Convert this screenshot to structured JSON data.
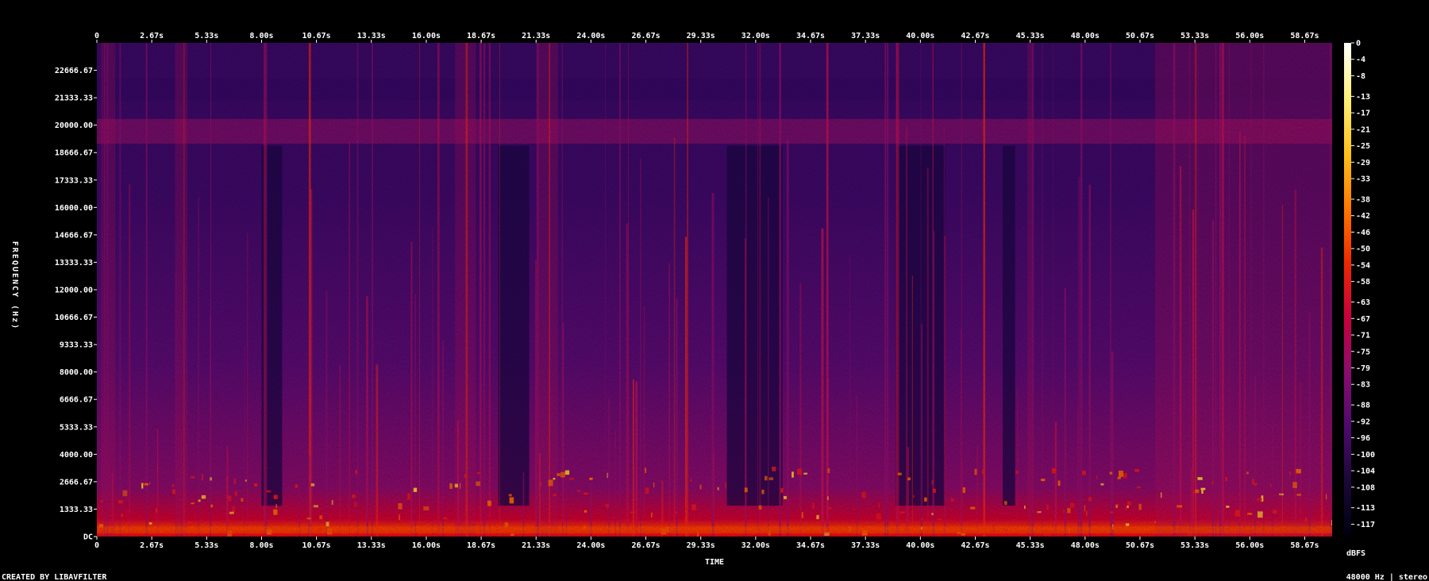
{
  "chart_data": {
    "type": "heatmap",
    "title": "",
    "xlabel": "TIME",
    "ylabel": "FREQUENCY (Hz)",
    "x_range_seconds": [
      0,
      60
    ],
    "y_range_hz": [
      0,
      24000
    ],
    "x_tick_labels": [
      "0",
      "2.67s",
      "5.33s",
      "8.00s",
      "10.67s",
      "13.33s",
      "16.00s",
      "18.67s",
      "21.33s",
      "24.00s",
      "26.67s",
      "29.33s",
      "32.00s",
      "34.67s",
      "37.33s",
      "40.00s",
      "42.67s",
      "45.33s",
      "48.00s",
      "50.67s",
      "53.33s",
      "56.00s",
      "58.67s"
    ],
    "x_tick_values": [
      0,
      2.6667,
      5.3333,
      8,
      10.6667,
      13.3333,
      16,
      18.6667,
      21.3333,
      24,
      26.6667,
      29.3333,
      32,
      34.6667,
      37.3333,
      40,
      42.6667,
      45.3333,
      48,
      50.6667,
      53.3333,
      56,
      58.6667
    ],
    "y_tick_labels": [
      "DC",
      "1333.33",
      "2666.67",
      "4000.00",
      "5333.33",
      "6666.67",
      "8000.00",
      "9333.33",
      "10666.67",
      "12000.00",
      "13333.33",
      "14666.67",
      "16000.00",
      "17333.33",
      "18666.67",
      "20000.00",
      "21333.33",
      "22666.67"
    ],
    "y_tick_values": [
      0,
      1333.33,
      2666.67,
      4000,
      5333.33,
      6666.67,
      8000,
      9333.33,
      10666.67,
      12000,
      13333.33,
      14666.67,
      16000,
      17333.33,
      18666.67,
      20000,
      21333.33,
      22666.67
    ],
    "colorbar": {
      "unit": "dBFS",
      "range": [
        -120,
        0
      ],
      "tick_labels": [
        "0",
        "-4",
        "-8",
        "-13",
        "-17",
        "-21",
        "-25",
        "-29",
        "-33",
        "-38",
        "-42",
        "-46",
        "-50",
        "-54",
        "-58",
        "-63",
        "-67",
        "-71",
        "-75",
        "-79",
        "-83",
        "-88",
        "-92",
        "-96",
        "-100",
        "-104",
        "-108",
        "-113",
        "-117"
      ],
      "colors": [
        "#ffffff",
        "#fff27a",
        "#ffc21c",
        "#ff7a00",
        "#f02800",
        "#c8003c",
        "#8a0d6e",
        "#4e0a6e",
        "#1a0838",
        "#000010"
      ]
    },
    "quiet_segments_seconds": [
      [
        8.0,
        9.0
      ],
      [
        19.5,
        21.0
      ],
      [
        30.6,
        33.3
      ],
      [
        38.8,
        41.2
      ],
      [
        44.0,
        44.6
      ]
    ],
    "loud_segments_seconds": [
      [
        0.2,
        0.9
      ],
      [
        3.8,
        4.4
      ],
      [
        17.4,
        18.4
      ],
      [
        21.4,
        22.4
      ],
      [
        45.2,
        45.5
      ],
      [
        51.4,
        60
      ]
    ],
    "noise_band_hz": [
      19100,
      20300
    ]
  },
  "footer": {
    "created_by": "CREATED BY LIBAVFILTER",
    "format": "48000 Hz | stereo"
  }
}
